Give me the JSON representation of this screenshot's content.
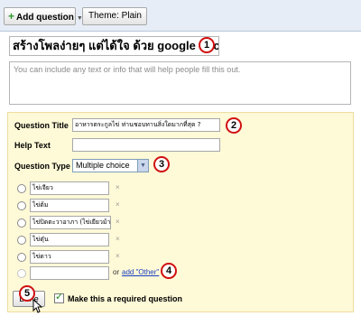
{
  "toolbar": {
    "add_question_label": "Add question",
    "theme_label": "Theme: Plain"
  },
  "form": {
    "title": "สร้างโพลง่ายๆ แต่ได้ใจ ด้วย google docs",
    "description_placeholder": "You can include any text or info that will help people fill this out."
  },
  "question_editor": {
    "question_title_label": "Question Title",
    "question_title_value": "อาหารตระกูลไข่ ท่านชอบทานสิ่งใดมากที่สุด ?",
    "help_text_label": "Help Text",
    "help_text_value": "",
    "question_type_label": "Question Type",
    "question_type_value": "Multiple choice",
    "choices": [
      "ไข่เจียว",
      "ไข่ต้ม",
      "ไข่ปิดตะวาอาภา (ไข่เยียวม้า)",
      "ไข่ตุ๋น",
      "ไข่ดาว"
    ],
    "remove_glyph": "×",
    "or_text": "or",
    "add_other_label": "add \"Other\"",
    "done_label": "Done",
    "required_label": "Make this a required question",
    "required_checked": true
  },
  "callouts": [
    "1",
    "2",
    "3",
    "4",
    "5"
  ],
  "colors": {
    "toolbar_bg": "#e6edf6",
    "panel_bg": "#fef9d7",
    "callout_ring": "#d01010",
    "link": "#1a3fc0"
  },
  "icons": [
    "plus-icon",
    "dropdown-arrow-icon",
    "remove-icon",
    "checkmark-icon",
    "mouse-cursor-icon"
  ]
}
